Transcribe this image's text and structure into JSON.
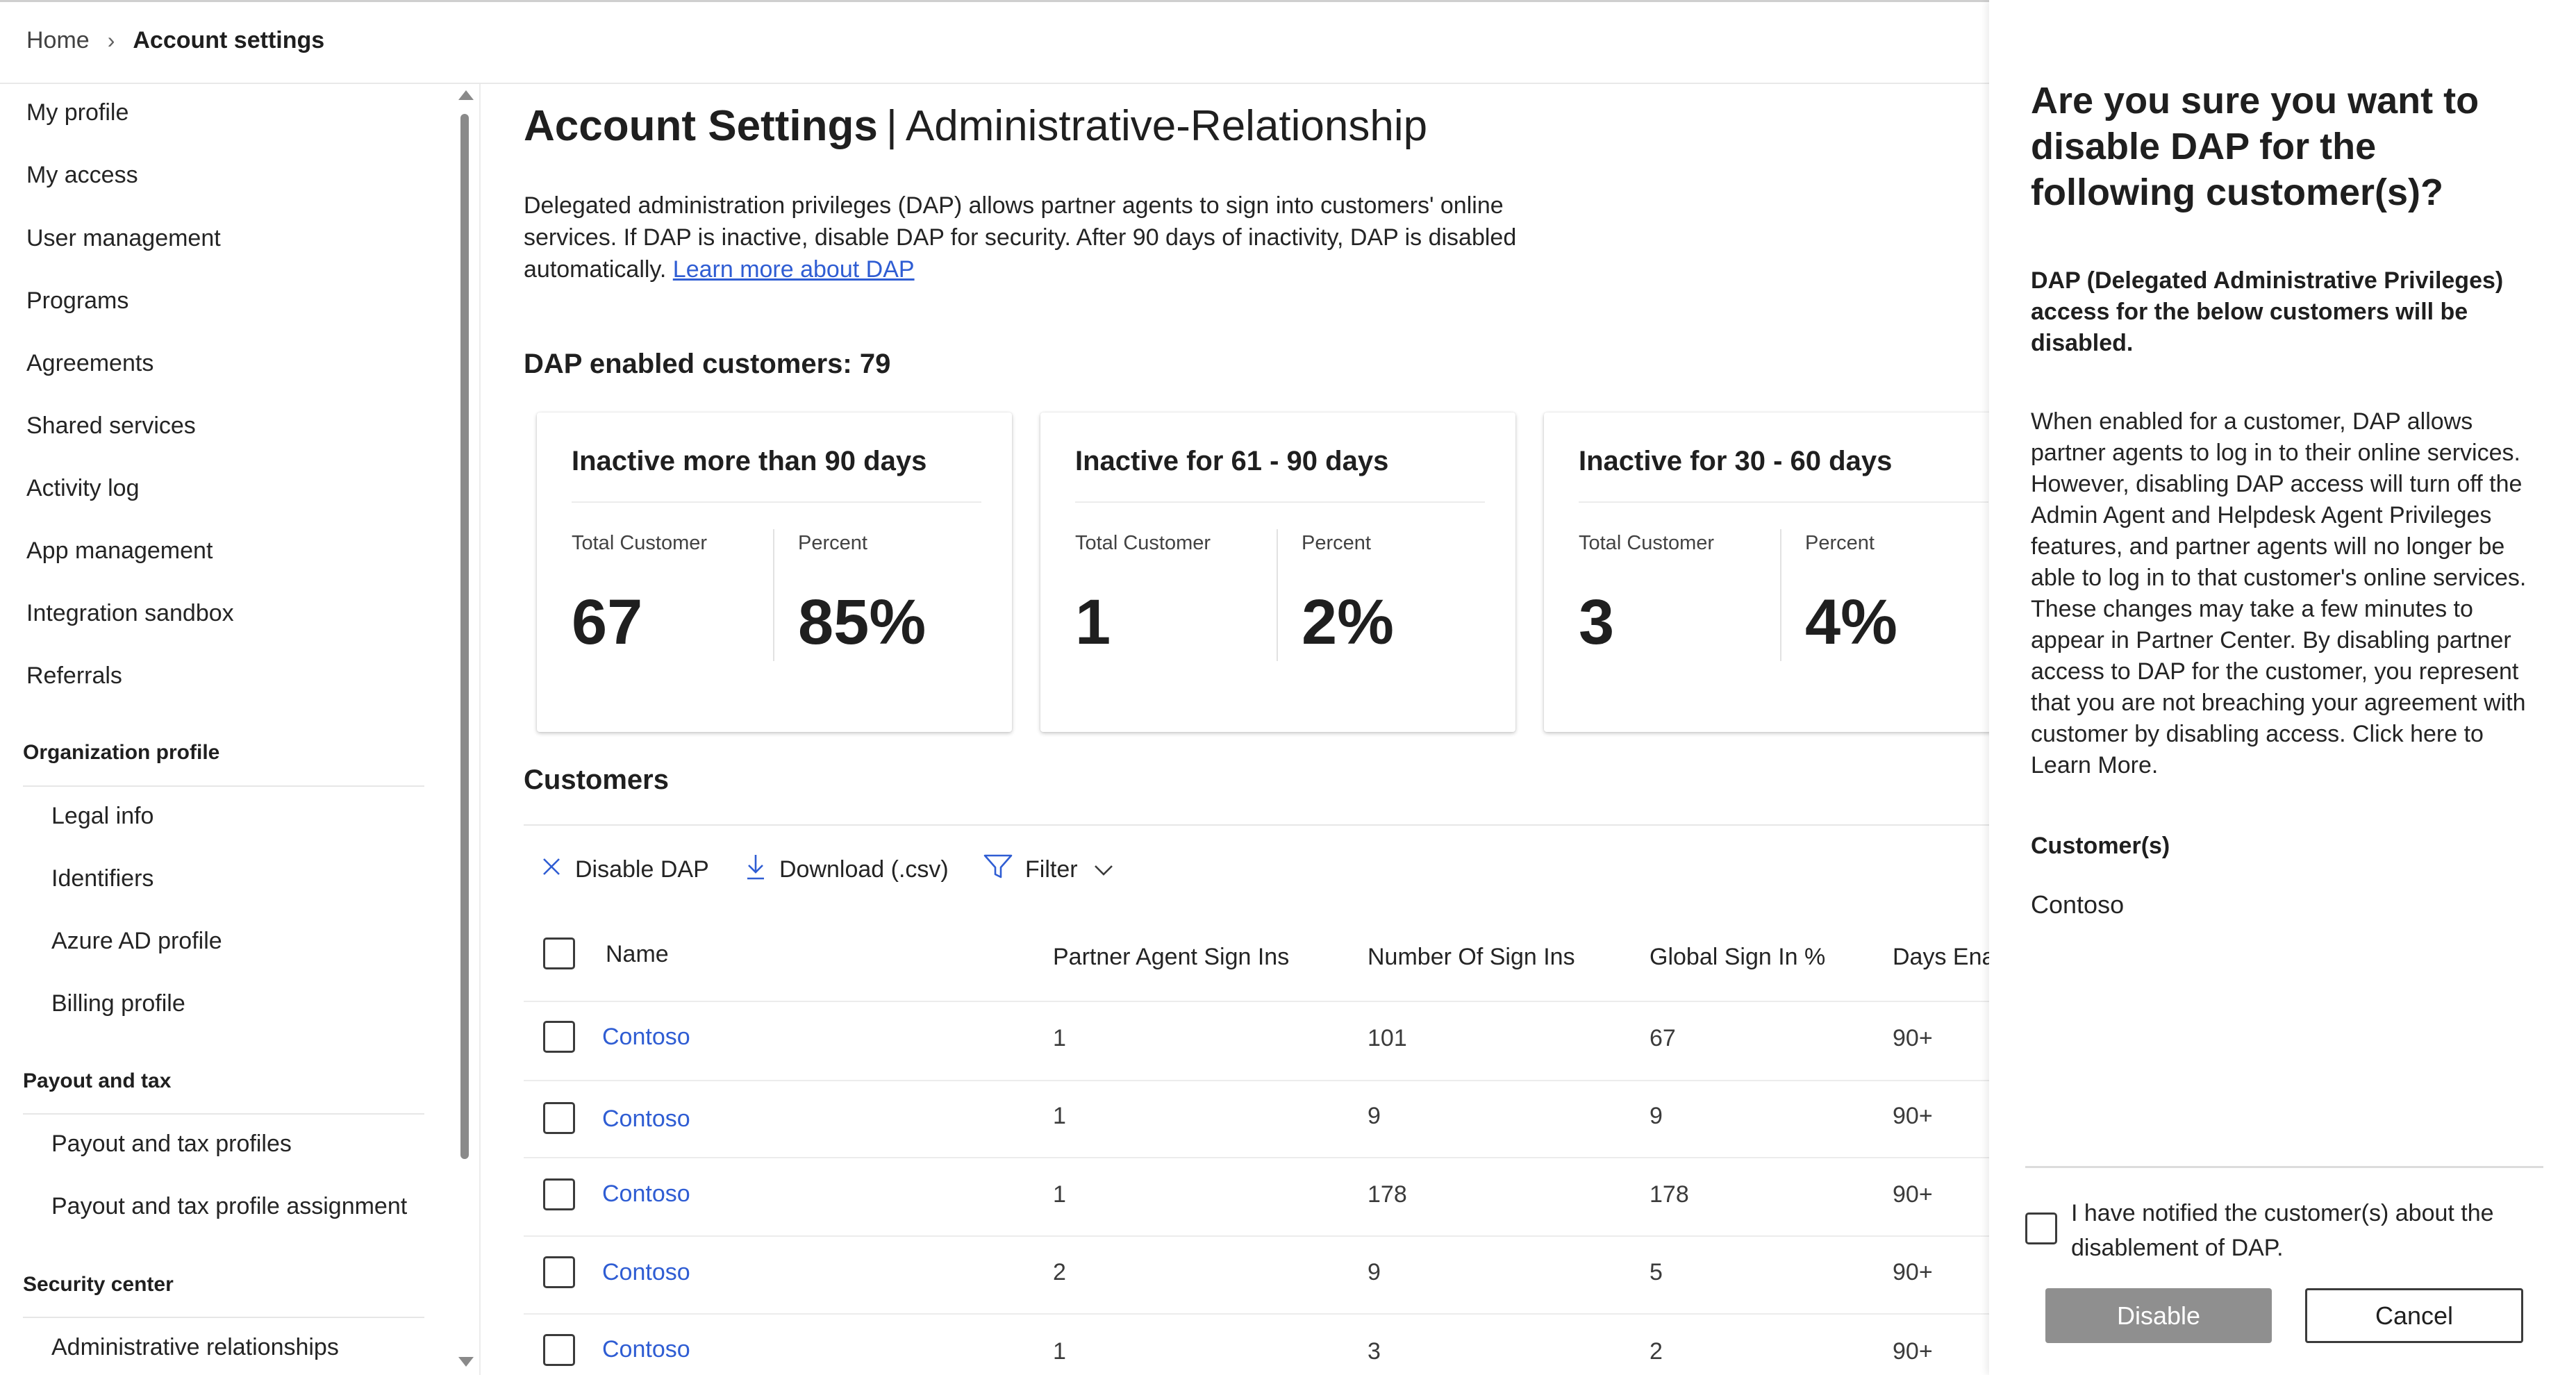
{
  "breadcrumb": {
    "home": "Home",
    "separator": "›",
    "current": "Account settings"
  },
  "sidebar": {
    "items": [
      "My profile",
      "My access",
      "User management",
      "Programs",
      "Agreements",
      "Shared services",
      "Activity log",
      "App management",
      "Integration sandbox",
      "Referrals"
    ],
    "sections": [
      {
        "title": "Organization profile",
        "items": [
          "Legal info",
          "Identifiers",
          "Azure AD profile",
          "Billing profile"
        ]
      },
      {
        "title": "Payout and tax",
        "items": [
          "Payout and tax profiles",
          "Payout and tax profile assignment"
        ]
      },
      {
        "title": "Security center",
        "items": [
          "Administrative relationships"
        ]
      }
    ]
  },
  "main": {
    "title_bold": "Account Settings",
    "title_sep": "|",
    "title_sub": "Administrative-Relationship",
    "intro_text": "Delegated administration privileges (DAP) allows partner agents to sign into customers' online services. If DAP is inactive, disable DAP for security. After 90 days of inactivity, DAP is disabled automatically. ",
    "intro_link": "Learn more about DAP",
    "dap_count": "DAP enabled customers: 79",
    "cards": [
      {
        "title": "Inactive more than 90 days",
        "label_total": "Total Customer",
        "label_percent": "Percent",
        "total": "67",
        "percent": "85%"
      },
      {
        "title": "Inactive for 61 - 90 days",
        "label_total": "Total Customer",
        "label_percent": "Percent",
        "total": "1",
        "percent": "2%"
      },
      {
        "title": "Inactive for 30 - 60 days",
        "label_total": "Total Customer",
        "label_percent": "Percent",
        "total": "3",
        "percent": "4%"
      }
    ],
    "customers_title": "Customers",
    "toolbar": {
      "disable": "Disable DAP",
      "download": "Download (.csv)",
      "filter": "Filter"
    },
    "table": {
      "headers": [
        "Name",
        "Partner Agent Sign Ins",
        "Number Of Sign Ins",
        "Global Sign In %",
        "Days Ena"
      ],
      "rows": [
        [
          "Contoso",
          "1",
          "101",
          "67",
          "90+"
        ],
        [
          "Contoso",
          "1",
          "9",
          "9",
          "90+"
        ],
        [
          "Contoso",
          "1",
          "178",
          "178",
          "90+"
        ],
        [
          "Contoso",
          "2",
          "9",
          "5",
          "90+"
        ],
        [
          "Contoso",
          "1",
          "3",
          "2",
          "90+"
        ]
      ]
    }
  },
  "panel": {
    "title": "Are you sure you want to disable DAP for the following customer(s)?",
    "warning": "DAP (Delegated Administrative Privileges) access for the below customers will be disabled.",
    "body": "When enabled for a customer, DAP allows partner agents to log in to their online services. However, disabling DAP access will turn off the Admin Agent and Helpdesk Agent Privileges features, and partner agents will no longer be able to log in to that customer's online services. These changes may take a few minutes to appear in Partner Center. By disabling partner access to DAP for the customer, you represent that you are not breaching your agreement with customer by disabling access. Click here to Learn More.",
    "customers_label": "Customer(s)",
    "customers_value": "Contoso",
    "confirm_label": "I have notified the customer(s) about the disablement of DAP.",
    "disable_button": "Disable",
    "cancel_button": "Cancel"
  },
  "colors": {
    "link": "#2f5dd3",
    "disabled_button": "#8f8f8f"
  }
}
